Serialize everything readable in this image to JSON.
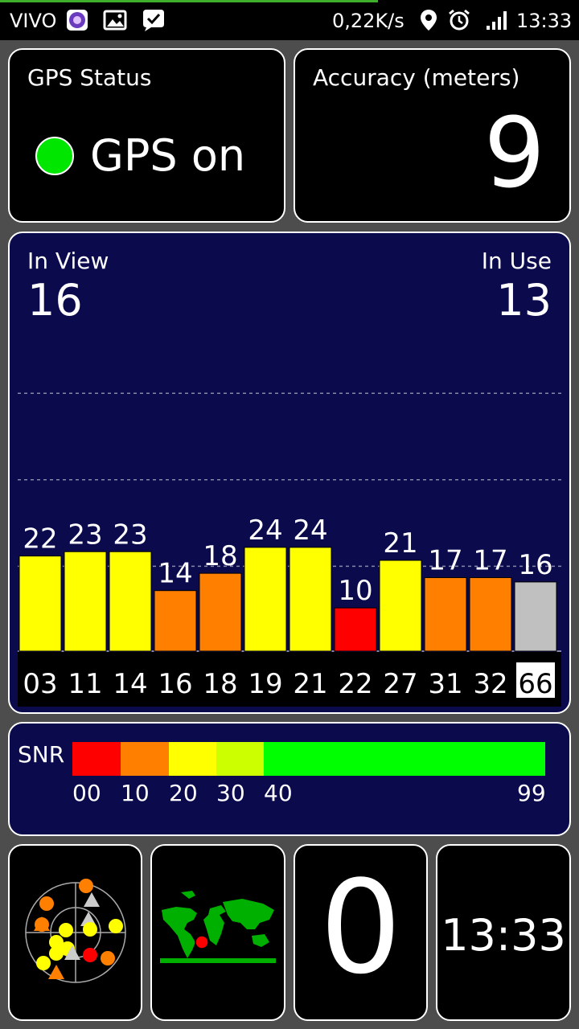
{
  "status_bar": {
    "carrier": "VIVO",
    "net_speed": "0,22K/s",
    "time": "13:33",
    "icons": [
      "app-icon",
      "gallery-icon",
      "check-icon",
      "location-icon",
      "alarm-icon",
      "signal-icon"
    ]
  },
  "gps_status": {
    "title": "GPS Status",
    "status": "GPS on",
    "indicator_color": "#00e600"
  },
  "accuracy": {
    "title": "Accuracy (meters)",
    "value": "9"
  },
  "satellites": {
    "in_view_label": "In View",
    "in_view": "16",
    "in_use_label": "In Use",
    "in_use": "13"
  },
  "chart_data": {
    "type": "bar",
    "categories": [
      "03",
      "11",
      "14",
      "16",
      "18",
      "19",
      "21",
      "22",
      "27",
      "31",
      "32",
      "66"
    ],
    "values": [
      22,
      23,
      23,
      14,
      18,
      24,
      24,
      10,
      21,
      17,
      17,
      16
    ],
    "colors": [
      "#ffff00",
      "#ffff00",
      "#ffff00",
      "#ff8000",
      "#ff8000",
      "#ffff00",
      "#ffff00",
      "#ff0000",
      "#ffff00",
      "#ff8000",
      "#ff8000",
      "#c0c0c0"
    ],
    "highlighted_category": "66",
    "ylim": [
      0,
      60
    ],
    "grid": true
  },
  "snr_legend": {
    "label": "SNR",
    "segments": [
      {
        "from": 0,
        "to": 10,
        "color": "#ff0000"
      },
      {
        "from": 10,
        "to": 20,
        "color": "#ff8000"
      },
      {
        "from": 20,
        "to": 30,
        "color": "#ffff00"
      },
      {
        "from": 30,
        "to": 40,
        "color": "#ccff00"
      },
      {
        "from": 40,
        "to": 99,
        "color": "#00ff00"
      }
    ],
    "ticks": [
      "00",
      "10",
      "20",
      "30",
      "40",
      "99"
    ]
  },
  "tiles": {
    "radar_icon": "satellite-radar-icon",
    "map_icon": "world-map-icon",
    "fix_count": "0",
    "clock": "13:33"
  }
}
